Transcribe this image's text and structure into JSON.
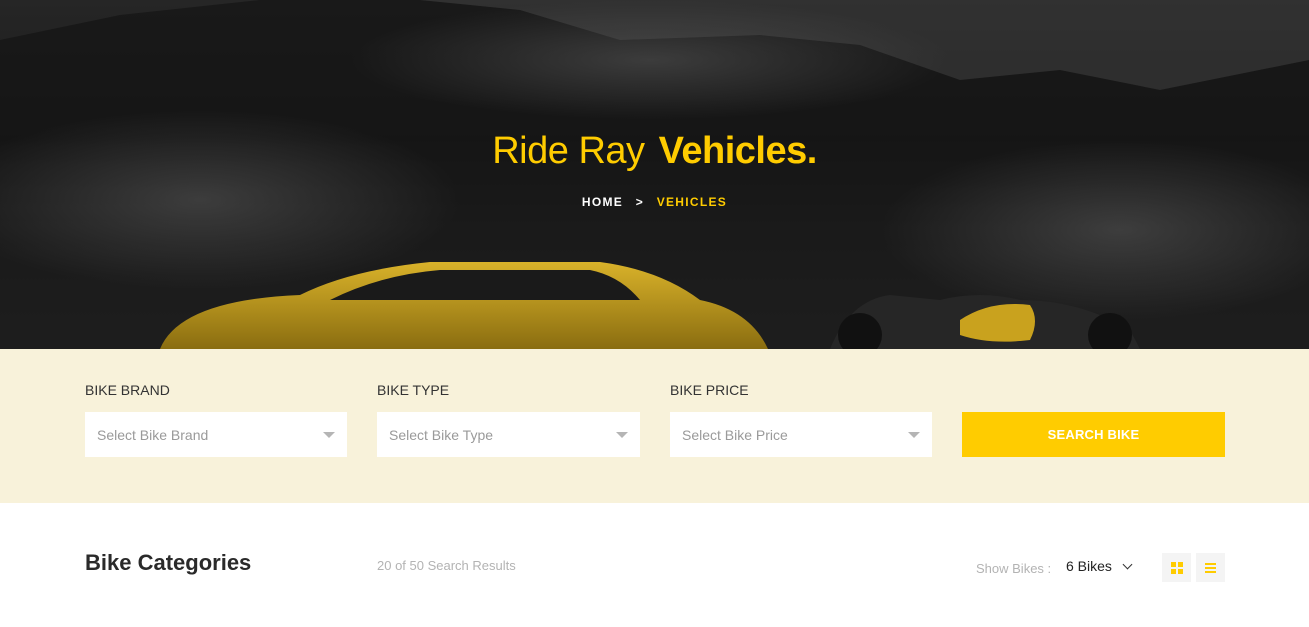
{
  "hero": {
    "title_light": "Ride Ray",
    "title_bold": "Vehicles.",
    "breadcrumb": {
      "home": "HOME",
      "separator": ">",
      "current": "VEHICLES"
    }
  },
  "search": {
    "brand": {
      "label": "BIKE BRAND",
      "placeholder": "Select Bike Brand"
    },
    "type": {
      "label": "BIKE TYPE",
      "placeholder": "Select Bike Type"
    },
    "price": {
      "label": "BIKE PRICE",
      "placeholder": "Select Bike Price"
    },
    "button_label": "SEARCH BIKE"
  },
  "listing": {
    "title": "Bike Categories",
    "results_text": "20 of 50 Search Results",
    "show_label": "Show Bikes :",
    "show_value": "6 Bikes",
    "view_grid_icon": "grid-icon",
    "view_list_icon": "list-icon"
  },
  "colors": {
    "accent": "#ffcc00",
    "search_bg": "#f8f2da",
    "hero_bg": "#1f1f1f"
  }
}
